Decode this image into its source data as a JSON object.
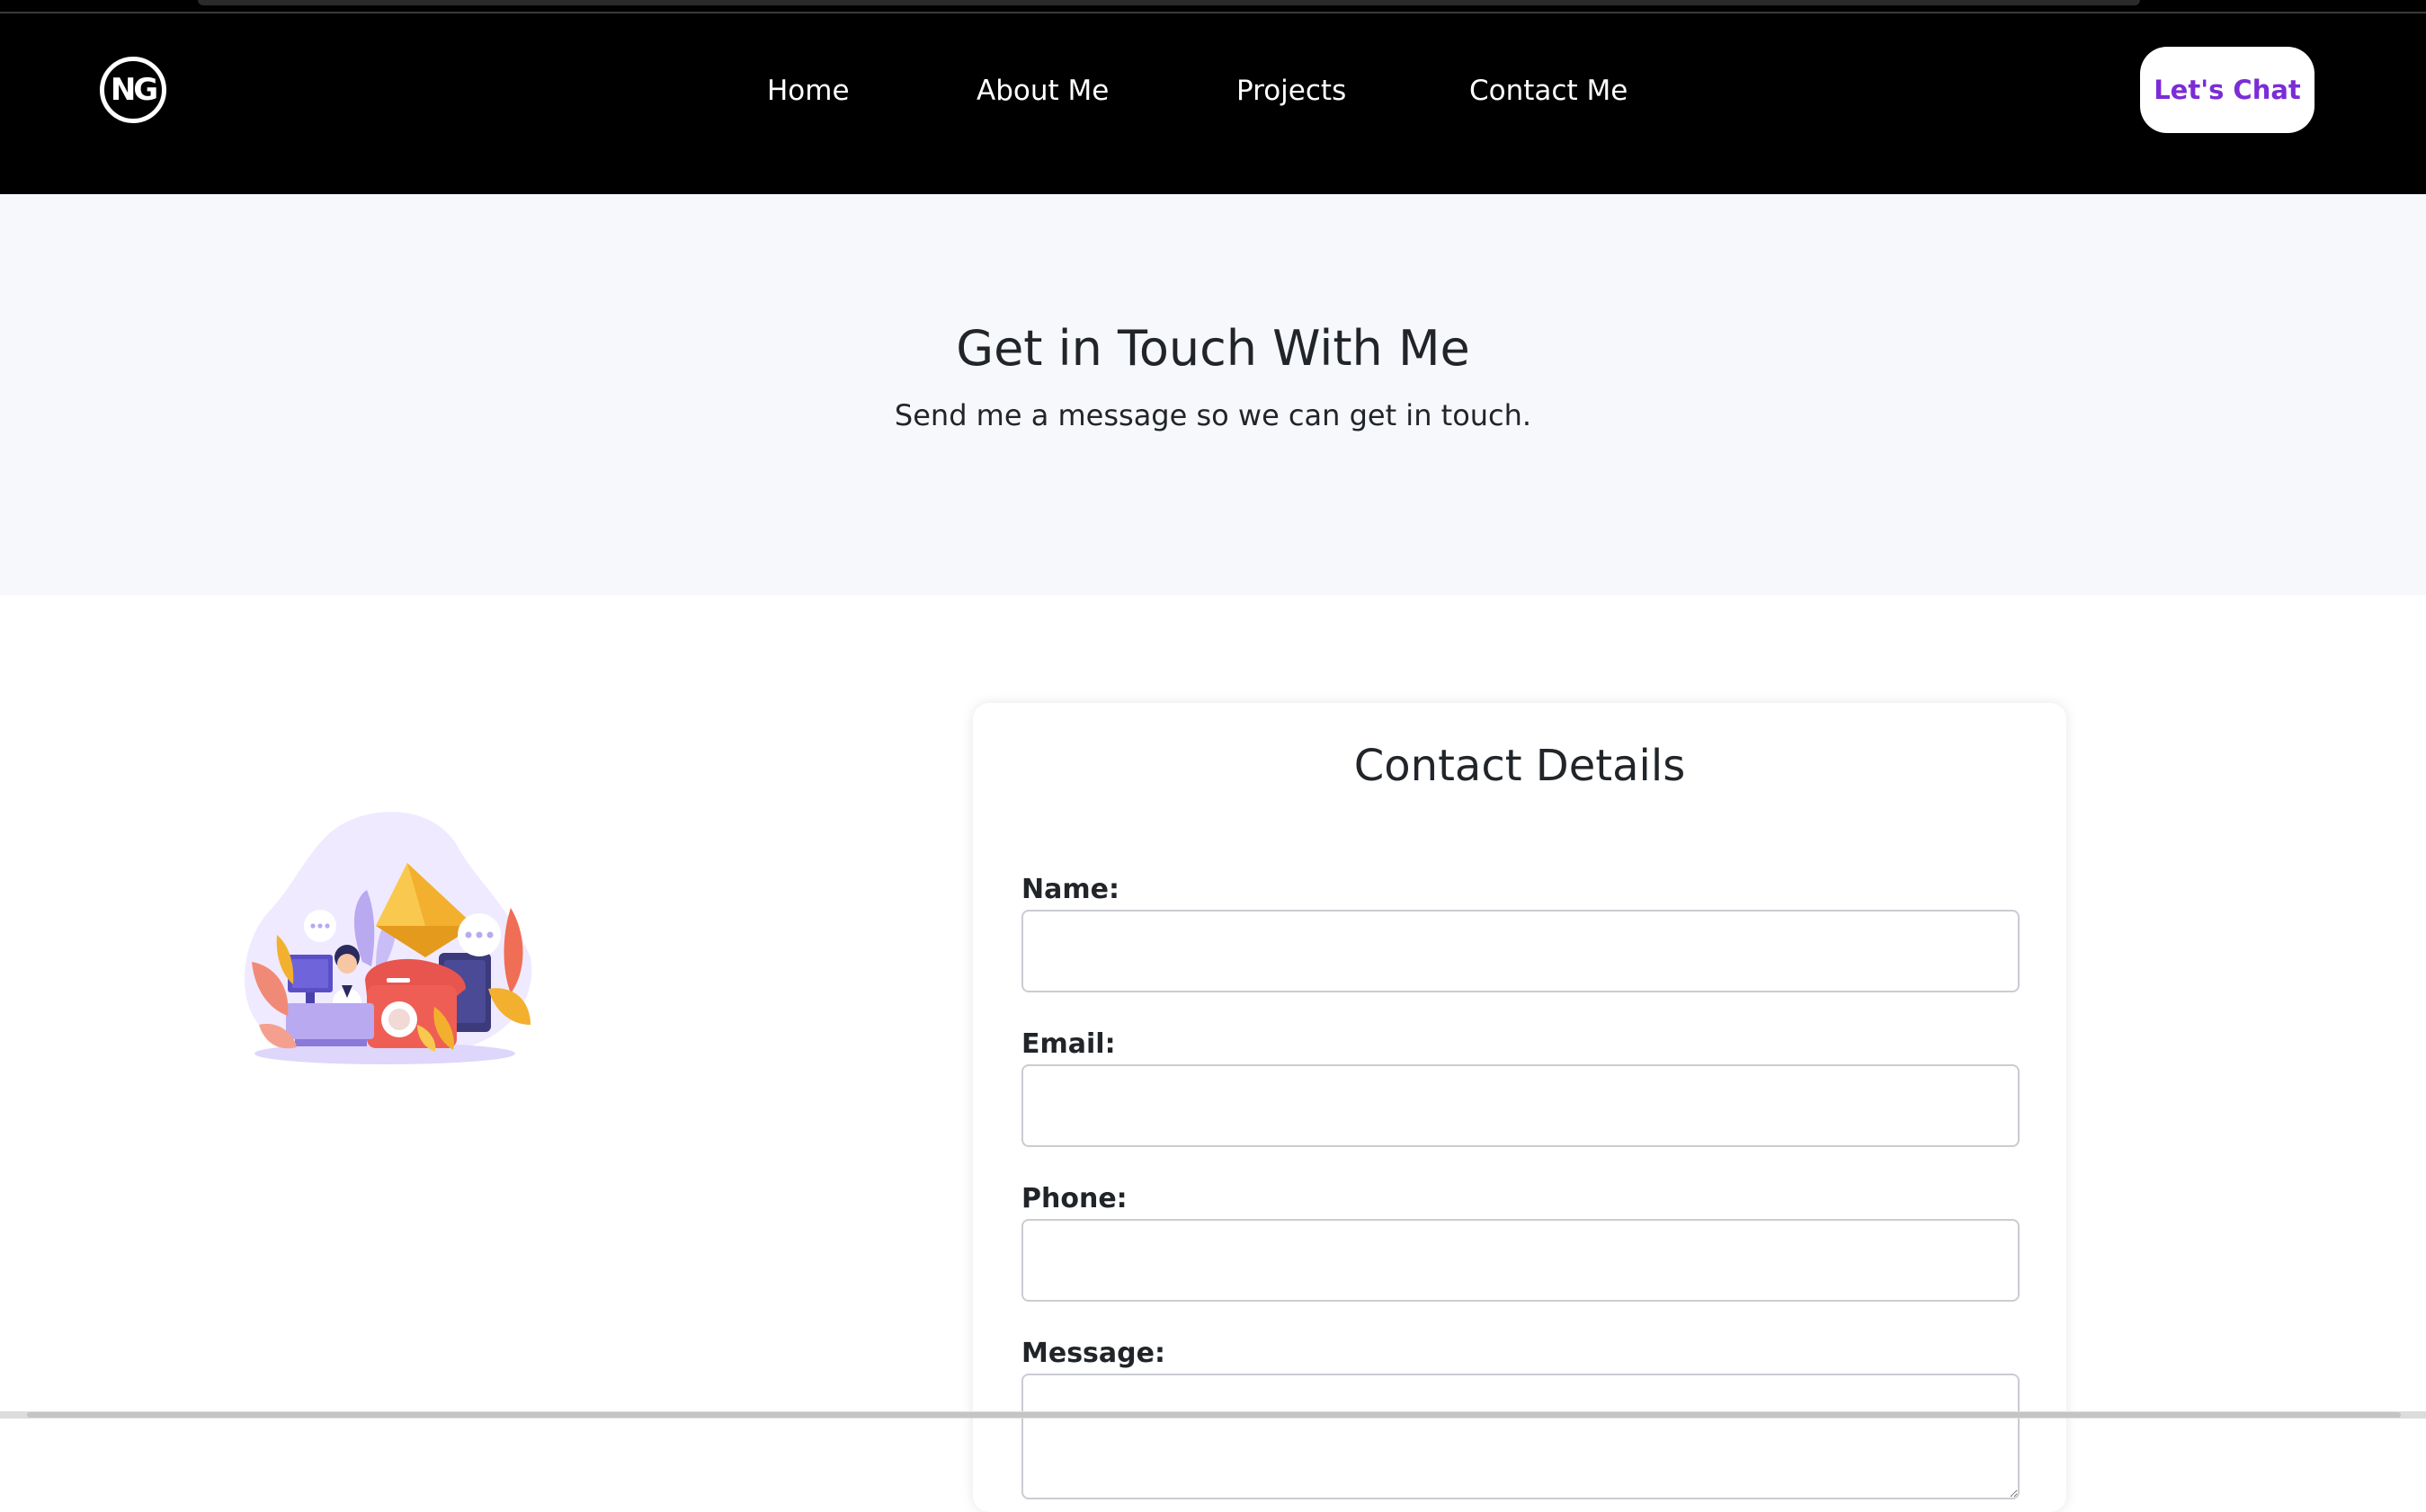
{
  "brand": {
    "logo_text": "NG"
  },
  "nav": {
    "items": [
      {
        "label": "Home"
      },
      {
        "label": "About Me"
      },
      {
        "label": "Projects"
      },
      {
        "label": "Contact Me"
      }
    ],
    "cta_label": "Let's Chat"
  },
  "hero": {
    "title": "Get in Touch With Me",
    "subtitle": "Send me a message so we can get in touch."
  },
  "contact_card": {
    "title": "Contact Details",
    "fields": [
      {
        "label": "Name:",
        "value": "",
        "placeholder": ""
      },
      {
        "label": "Email:",
        "value": "",
        "placeholder": ""
      },
      {
        "label": "Phone:",
        "value": "",
        "placeholder": ""
      },
      {
        "label": "Message:",
        "value": "",
        "placeholder": ""
      }
    ]
  },
  "colors": {
    "navbar_bg": "#000000",
    "cta_text": "#7b2cd6",
    "hero_bg": "#f7f8fb",
    "text_dark": "#212529"
  },
  "icons": {
    "illustration": "contact-illustration"
  }
}
